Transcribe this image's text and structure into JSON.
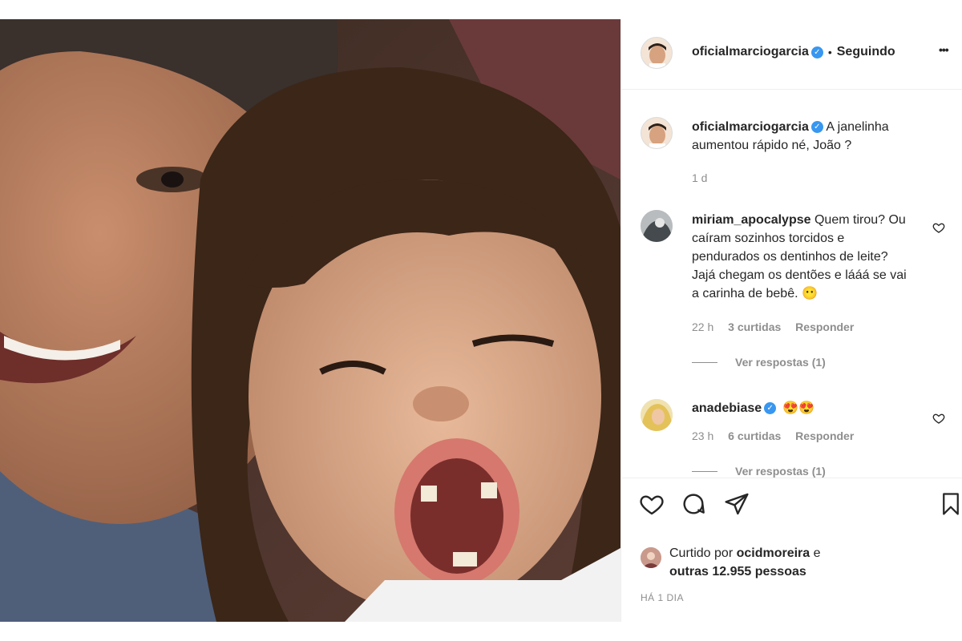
{
  "post": {
    "image_alt": "Selfie de pai e filho mostrando a janelinha nos dentes"
  },
  "header": {
    "username": "oficialmarciogarcia",
    "separator": "•",
    "follow_label": "Seguindo",
    "more_label": "•••"
  },
  "caption": {
    "username": "oficialmarciogarcia",
    "text": "A janelinha aumentou rápido né, João ?",
    "time": "1 d"
  },
  "comments": [
    {
      "username": "miriam_apocalypse",
      "text": "Quem tirou? Ou caíram sozinhos torcidos e pendurados os dentinhos de leite? Jajá chegam os dentões e lááá se vai a carinha de bebê. 😶",
      "time": "22 h",
      "likes": "3 curtidas",
      "reply": "Responder",
      "view_replies": "Ver respostas (1)"
    },
    {
      "username": "anadebiase",
      "text": "😍😍",
      "time": "23 h",
      "likes": "6 curtidas",
      "reply": "Responder",
      "view_replies": "Ver respostas (1)"
    }
  ],
  "likes": {
    "prefix": "Curtido por ",
    "user": "ocidmoreira",
    "middle": " e",
    "others": "outras 12.955 pessoas"
  },
  "date_label": "HÁ 1 DIA",
  "colors": {
    "verified": "#3897f0",
    "text": "#262626",
    "secondary": "#8e8e8e"
  }
}
